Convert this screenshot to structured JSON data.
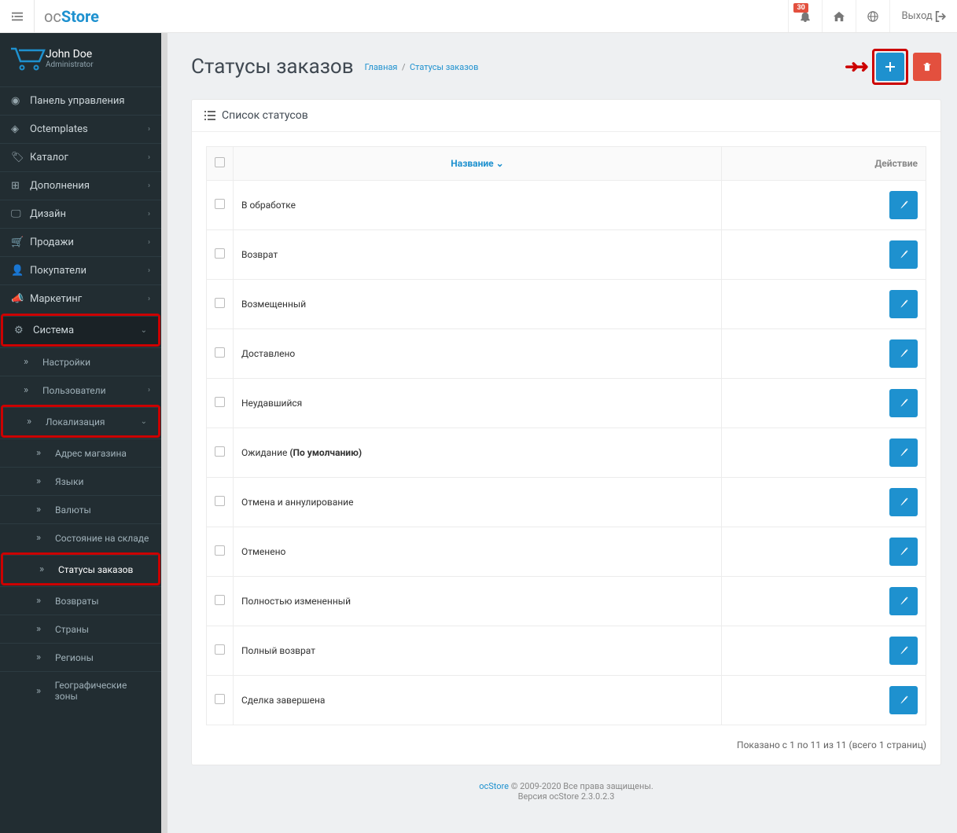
{
  "header": {
    "logo_prefix": "oc",
    "logo_accent": "Store",
    "notif_count": "30",
    "logout": "Выход"
  },
  "user": {
    "name": "John Doe",
    "role": "Administrator"
  },
  "sidebar": {
    "dashboard": "Панель управления",
    "octemplates": "Octemplates",
    "catalog": "Каталог",
    "extensions": "Дополнения",
    "design": "Дизайн",
    "sales": "Продажи",
    "customers": "Покупатели",
    "marketing": "Маркетинг",
    "system": "Система",
    "settings": "Настройки",
    "users": "Пользователи",
    "localization": "Локализация",
    "store_address": "Адрес магазина",
    "languages": "Языки",
    "currencies": "Валюты",
    "stock_statuses": "Состояние на складе",
    "order_statuses": "Статусы заказов",
    "returns": "Возвраты",
    "countries": "Страны",
    "regions": "Регионы",
    "geo_zones": "Географические зоны"
  },
  "page": {
    "title": "Статусы заказов",
    "breadcrumb_home": "Главная",
    "breadcrumb_sep": "/",
    "breadcrumb_current": "Статусы заказов"
  },
  "panel": {
    "heading": "Список статусов"
  },
  "table": {
    "col_name": "Название",
    "col_action": "Действие",
    "default_suffix": "(По умолчанию)",
    "rows": [
      {
        "name": "В обработке",
        "default": false
      },
      {
        "name": "Возврат",
        "default": false
      },
      {
        "name": "Возмещенный",
        "default": false
      },
      {
        "name": "Доставлено",
        "default": false
      },
      {
        "name": "Неудавшийся",
        "default": false
      },
      {
        "name": "Ожидание",
        "default": true
      },
      {
        "name": "Отмена и аннулирование",
        "default": false
      },
      {
        "name": "Отменено",
        "default": false
      },
      {
        "name": "Полностью измененный",
        "default": false
      },
      {
        "name": "Полный возврат",
        "default": false
      },
      {
        "name": "Сделка завершена",
        "default": false
      }
    ],
    "pagination": "Показано с 1 по 11 из 11 (всего 1 страниц)"
  },
  "footer": {
    "link": "ocStore",
    "copyright": " © 2009-2020 Все права защищены.",
    "version": "Версия ocStore 2.3.0.2.3"
  }
}
